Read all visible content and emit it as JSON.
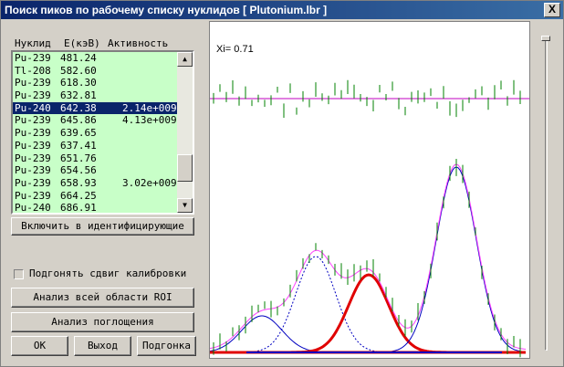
{
  "window": {
    "title": "Поиск пиков по рабочему списку нуклидов [ Plutonium.lbr ]",
    "close_label": "X"
  },
  "table": {
    "headers": [
      "Нуклид",
      "E(кэВ)",
      "Активность"
    ],
    "rows": [
      [
        "Pu-239",
        "481.24",
        ""
      ],
      [
        "Tl-208",
        "582.60",
        ""
      ],
      [
        "Pu-239",
        "618.30",
        ""
      ],
      [
        "Pu-239",
        "632.81",
        ""
      ],
      [
        "Pu-240",
        "642.38",
        "2.14e+009*"
      ],
      [
        "Pu-239",
        "645.86",
        "4.13e+009*"
      ],
      [
        "Pu-239",
        "639.65",
        ""
      ],
      [
        "Pu-239",
        "637.41",
        ""
      ],
      [
        "Pu-239",
        "651.76",
        ""
      ],
      [
        "Pu-239",
        "654.56",
        ""
      ],
      [
        "Pu-239",
        "658.93",
        "3.02e+009*"
      ],
      [
        "Pu-239",
        "664.25",
        ""
      ],
      [
        "Pu-240",
        "686.91",
        ""
      ]
    ],
    "selected_index": 4
  },
  "buttons": {
    "include": "Включить в идентифицирующие",
    "analyze_roi": "Анализ всей области ROI",
    "absorption": "Анализ поглощения",
    "ok": "OK",
    "exit": "Выход",
    "fit": "Подгонка"
  },
  "calibration": {
    "label": "Подгонять сдвиг калибровки",
    "checked": false
  },
  "plot": {
    "xi_label": "Xi=",
    "xi_value": "0.71",
    "colors": {
      "residual_line": "#c000c0",
      "error_bars": "#008000",
      "component_fit": "#0000c0",
      "highlighted_component": "#e00000",
      "total_fit": "#ff40ff"
    }
  }
}
